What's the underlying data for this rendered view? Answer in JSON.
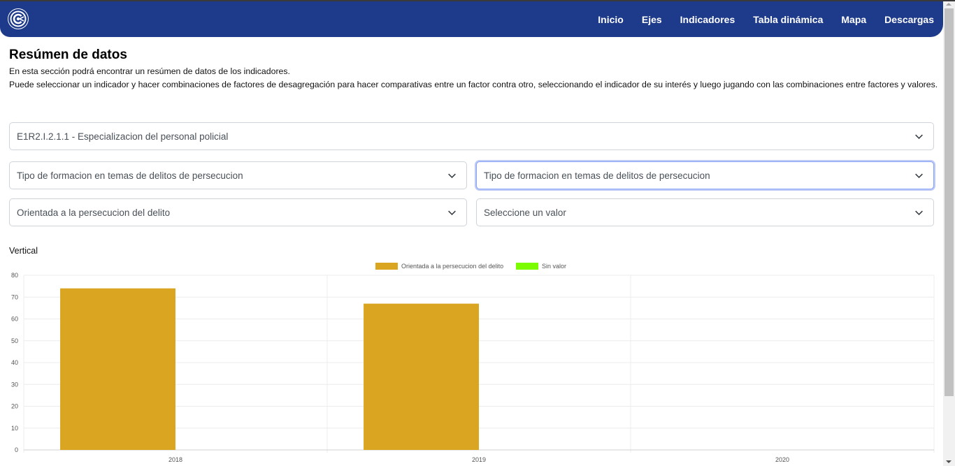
{
  "nav": {
    "items": [
      "Inicio",
      "Ejes",
      "Indicadores",
      "Tabla dinámica",
      "Mapa",
      "Descargas"
    ]
  },
  "page": {
    "title": "Resúmen de datos",
    "desc1": "En esta sección podrá encontrar un resúmen de datos de los indicadores.",
    "desc2": "Puede seleccionar un indicador y hacer combinaciones de factores de desagregación para hacer comparativas entre un factor contra otro, seleccionando el indicador de su interés y luego jugando con las combinaciones entre factores y valores."
  },
  "selects": {
    "indicator": "E1R2.I.2.1.1 - Especializacion del personal policial",
    "factor_left": "Tipo de formacion en temas de delitos de persecucion",
    "factor_right": "Tipo de formacion en temas de delitos de persecucion",
    "value_left": "Orientada a la persecucion del delito",
    "value_right": "Seleccione un valor"
  },
  "chart_section": {
    "label": "Vertical"
  },
  "colors": {
    "navbar": "#1e3a8a",
    "series1": "#daa520",
    "series2": "#7cfc00"
  },
  "chart_data": {
    "type": "bar",
    "categories": [
      "2018",
      "2019",
      "2020"
    ],
    "series": [
      {
        "name": "Orientada a la persecucion del delito",
        "values": [
          74,
          67,
          0
        ],
        "color": "#daa520"
      },
      {
        "name": "Sin valor",
        "values": [
          0,
          0,
          0
        ],
        "color": "#7cfc00"
      }
    ],
    "ylim": [
      0,
      80
    ],
    "yticks": [
      0,
      10,
      20,
      30,
      40,
      50,
      60,
      70,
      80
    ],
    "legend_position": "top-center",
    "grid": true
  }
}
